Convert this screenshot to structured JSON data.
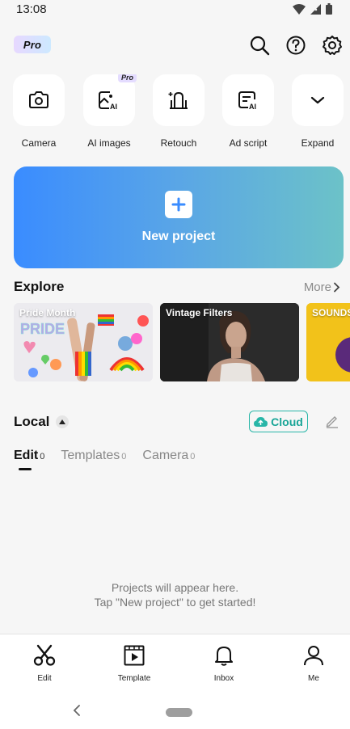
{
  "status_bar": {
    "time": "13:08"
  },
  "header": {
    "pro_label": "Pro",
    "search_icon": "search-icon",
    "help_icon": "help-icon",
    "settings_icon": "gear-icon"
  },
  "tools": [
    {
      "label": "Camera",
      "icon": "camera-icon"
    },
    {
      "label": "AI images",
      "icon": "ai-image-icon",
      "badge": "Pro"
    },
    {
      "label": "Retouch",
      "icon": "retouch-icon"
    },
    {
      "label": "Ad script",
      "icon": "ad-script-icon"
    },
    {
      "label": "Expand",
      "icon": "chevron-down-icon"
    }
  ],
  "new_project": {
    "label": "New project"
  },
  "explore": {
    "title": "Explore",
    "more_label": "More",
    "cards": [
      {
        "title": "Pride Month"
      },
      {
        "title": "Vintage Filters"
      },
      {
        "title": "SOUNDS"
      }
    ]
  },
  "local": {
    "title": "Local",
    "cloud_label": "Cloud",
    "tabs": [
      {
        "label": "Edit",
        "count": "0"
      },
      {
        "label": "Templates",
        "count": "0"
      },
      {
        "label": "Camera",
        "count": "0"
      }
    ],
    "empty_line1": "Projects will appear here.",
    "empty_line2": "Tap \"New project\" to get started!"
  },
  "bottom_nav": [
    {
      "label": "Edit",
      "icon": "scissors-icon"
    },
    {
      "label": "Template",
      "icon": "template-icon"
    },
    {
      "label": "Inbox",
      "icon": "bell-icon"
    },
    {
      "label": "Me",
      "icon": "person-icon"
    }
  ],
  "colors": {
    "accent_teal": "#29b6a8",
    "banner_start": "#3a8cff",
    "banner_end": "#6cc2c8"
  }
}
